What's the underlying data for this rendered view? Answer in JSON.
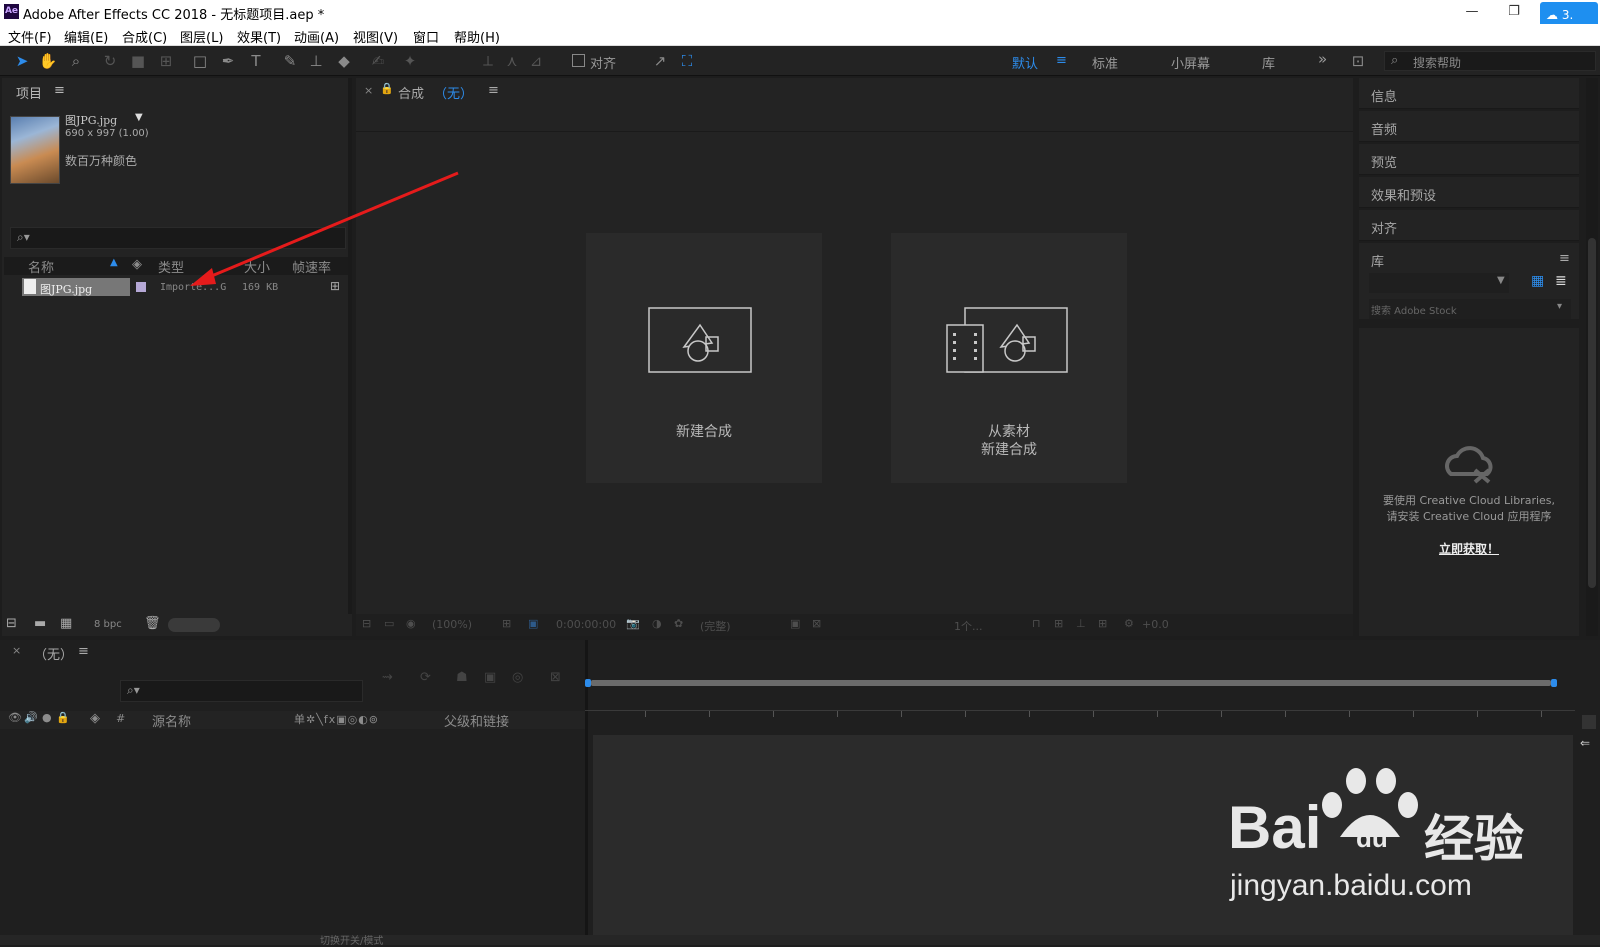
{
  "window": {
    "app_badge": "Ae",
    "title": "Adobe After Effects CC 2018 - 无标题项目.aep *",
    "cloud_badge": "3."
  },
  "menu": [
    "文件(F)",
    "编辑(E)",
    "合成(C)",
    "图层(L)",
    "效果(T)",
    "动画(A)",
    "视图(V)",
    "窗口",
    "帮助(H)"
  ],
  "toolbar": {
    "snap_label": "对齐",
    "workspaces": [
      "默认",
      "标准",
      "小屏幕",
      "库"
    ],
    "active_workspace": "默认",
    "more": "»",
    "search_placeholder": "搜索帮助"
  },
  "project": {
    "tab": "项目",
    "file_name": "图JPG.jpg",
    "file_dims": "690 x 997 (1.00)",
    "file_color": "数百万种颜色",
    "search_icon": "⌕▾",
    "columns": [
      "名称",
      "类型",
      "大小",
      "帧速率"
    ],
    "row": {
      "name": "图JPG.jpg",
      "type": "Importe...G",
      "size": "169 KB"
    },
    "bpc": "8 bpc"
  },
  "comp": {
    "tab_label": "合成",
    "tab_value": "（无）",
    "card1": "新建合成",
    "card2_l1": "从素材",
    "card2_l2": "新建合成",
    "footer": {
      "zoom": "(100%)",
      "time": "0:00:00:00",
      "res": "(完整)",
      "views": "1个...",
      "exposure": "+0.0"
    }
  },
  "right": {
    "tabs": [
      "信息",
      "音频",
      "预览",
      "效果和预设",
      "对齐"
    ],
    "library": {
      "title": "库",
      "stock_placeholder": "搜索 Adobe Stock",
      "msg_l1": "要使用 Creative Cloud Libraries,",
      "msg_l2": "请安装 Creative Cloud 应用程序",
      "link": "立即获取！"
    }
  },
  "timeline": {
    "tab": "（无）",
    "col_source": "源名称",
    "col_parent": "父级和链接",
    "col_hash": "#",
    "switches": "单✲╲fx▣◎◐⊚",
    "footer_mode": "切换开关/模式"
  },
  "watermark": {
    "brand": "Bai",
    "brand2": "du",
    "cn": "经验",
    "url": "jingyan.baidu.com"
  },
  "colors": {
    "accent": "#2d8ceb",
    "arrow": "#e51b1b",
    "panel": "#232323",
    "bg": "#1d1d1d"
  }
}
